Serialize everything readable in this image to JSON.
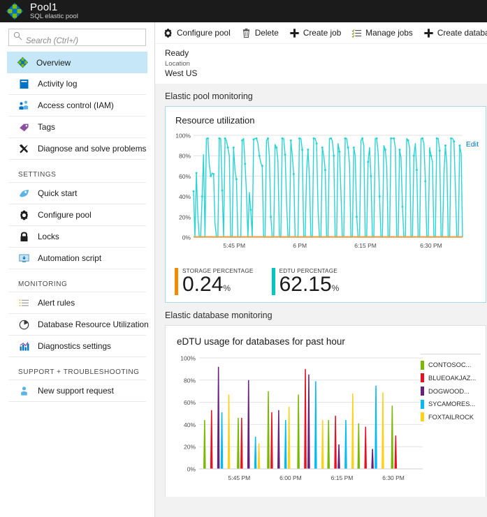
{
  "titlebar": {
    "icon": "sql-elastic-pool-icon",
    "title": "Pool1",
    "subtitle": "SQL elastic pool"
  },
  "sidebar": {
    "search": {
      "placeholder": "Search (Ctrl+/)",
      "icon": "search-icon"
    },
    "items": [
      {
        "label": "Overview",
        "icon": "overview-icon",
        "active": true
      },
      {
        "label": "Activity log",
        "icon": "activity-log-icon",
        "active": false
      },
      {
        "label": "Access control (IAM)",
        "icon": "access-control-icon",
        "active": false
      },
      {
        "label": "Tags",
        "icon": "tag-icon",
        "active": false
      },
      {
        "label": "Diagnose and solve problems",
        "icon": "wrench-icon",
        "active": false
      }
    ],
    "groups": [
      {
        "label": "SETTINGS",
        "items": [
          {
            "label": "Quick start",
            "icon": "rocket-icon"
          },
          {
            "label": "Configure pool",
            "icon": "gear-icon"
          },
          {
            "label": "Locks",
            "icon": "lock-icon"
          },
          {
            "label": "Automation script",
            "icon": "automation-script-icon"
          }
        ]
      },
      {
        "label": "MONITORING",
        "items": [
          {
            "label": "Alert rules",
            "icon": "alert-rules-icon"
          },
          {
            "label": "Database Resource Utilization",
            "icon": "pie-chart-icon"
          },
          {
            "label": "Diagnostics settings",
            "icon": "bar-chart-icon"
          }
        ]
      },
      {
        "label": "SUPPORT + TROUBLESHOOTING",
        "items": [
          {
            "label": "New support request",
            "icon": "support-request-icon"
          }
        ]
      }
    ]
  },
  "toolbar": {
    "buttons": [
      {
        "label": "Configure pool",
        "icon": "gear-icon"
      },
      {
        "label": "Delete",
        "icon": "trash-icon"
      },
      {
        "label": "Create job",
        "icon": "plus-icon"
      },
      {
        "label": "Manage jobs",
        "icon": "list-icon"
      },
      {
        "label": "Create database",
        "icon": "plus-icon"
      },
      {
        "label": "",
        "icon": "pin-icon"
      }
    ]
  },
  "status": {
    "state": "Ready",
    "location_label": "Location",
    "location_value": "West US"
  },
  "sections": {
    "pool_monitoring_title": "Elastic pool monitoring",
    "database_monitoring_title": "Elastic database monitoring"
  },
  "resource_tile": {
    "title": "Resource utilization",
    "edit_label": "Edit",
    "metrics": [
      {
        "label": "STORAGE PERCENTAGE",
        "value": "0.24",
        "unit": "%",
        "color": "#f28b00"
      },
      {
        "label": "EDTU PERCENTAGE",
        "value": "62.15",
        "unit": "%",
        "color": "#00c6c6"
      }
    ]
  },
  "edtu_tile": {
    "title": "eDTU usage for databases for past hour"
  },
  "chart_data": [
    {
      "type": "line",
      "title": "Resource utilization",
      "xlabel": "",
      "ylabel": "",
      "ylim": [
        0,
        100
      ],
      "ytick_labels": [
        "0%",
        "20%",
        "40%",
        "60%",
        "80%",
        "100%"
      ],
      "yticks": [
        0,
        20,
        40,
        60,
        80,
        100
      ],
      "xtick_labels": [
        "5:45 PM",
        "6 PM",
        "6:15 PM",
        "6:30 PM"
      ],
      "grid": true,
      "legend": "none",
      "series": [
        {
          "name": "EDTU PERCENTAGE",
          "color": "#2bd4d4",
          "values": [
            45,
            0,
            63,
            22,
            0,
            0,
            40,
            81,
            0,
            97,
            97,
            72,
            60,
            63,
            62,
            14,
            0,
            0,
            97,
            97,
            46,
            0,
            97,
            95,
            88,
            80,
            0,
            0,
            88,
            65,
            57,
            0,
            0,
            0,
            95,
            97,
            72,
            43,
            0,
            44,
            27,
            0,
            96,
            97,
            97,
            92,
            80,
            73,
            70,
            0,
            0,
            95,
            97,
            80,
            20,
            0,
            0,
            91,
            88,
            75,
            0,
            0,
            97,
            97,
            81,
            35,
            0,
            0,
            95,
            80,
            62,
            0,
            0,
            0,
            97,
            97,
            86,
            0,
            0,
            64,
            86,
            58,
            0,
            0,
            97,
            97,
            92,
            27,
            0,
            0,
            88,
            80,
            66,
            0,
            0,
            97,
            97,
            95,
            80,
            0,
            0,
            92,
            84,
            45,
            0,
            0,
            97,
            97,
            88,
            72,
            0,
            0,
            88,
            80,
            20,
            0,
            0,
            95,
            97,
            90,
            0,
            0,
            74,
            88,
            60,
            0,
            0,
            97,
            97,
            83,
            40,
            0,
            0,
            90,
            86,
            70,
            0,
            0,
            97,
            97,
            97,
            88,
            0,
            0,
            86,
            78,
            30,
            0,
            0,
            97,
            95,
            88,
            0,
            0,
            80,
            92,
            66,
            0,
            0,
            97,
            97,
            92,
            55,
            0,
            0,
            88,
            80,
            74,
            0,
            0,
            97,
            97,
            85,
            0,
            0,
            62,
            90,
            72,
            0,
            0,
            97,
            97,
            94,
            48,
            0,
            0,
            90,
            82,
            0
          ]
        },
        {
          "name": "STORAGE PERCENTAGE",
          "color": "#f28b00",
          "values": [
            0.24
          ]
        }
      ]
    },
    {
      "type": "bar",
      "title": "eDTU usage for databases for past hour",
      "xlabel": "",
      "ylabel": "",
      "ylim": [
        0,
        100
      ],
      "ytick_labels": [
        "0%",
        "20%",
        "40%",
        "60%",
        "80%",
        "100%"
      ],
      "yticks": [
        0,
        20,
        40,
        60,
        80,
        100
      ],
      "xtick_labels": [
        "5:45 PM",
        "6:00 PM",
        "6:15 PM",
        "6:30 PM"
      ],
      "grid": true,
      "legend": "right",
      "series": [
        {
          "name": "CONTOSOC...",
          "color": "#7ab800",
          "values": [
            44,
            46,
            70,
            67,
            44,
            41,
            57
          ]
        },
        {
          "name": "BLUEOAKJAZ...",
          "color": "#e81123",
          "values": [
            53,
            46,
            51,
            90,
            48,
            38,
            30
          ]
        },
        {
          "name": "DOGWOOD...",
          "color": "#68217a",
          "values": [
            92,
            80,
            53,
            85,
            22,
            18
          ]
        },
        {
          "name": "SYCAMORES...",
          "color": "#00bcf2",
          "values": [
            51,
            29,
            44,
            79,
            44,
            75
          ]
        },
        {
          "name": "FOXTAILROCK",
          "color": "#fcd116",
          "values": [
            67,
            23,
            56,
            44,
            68,
            69
          ]
        }
      ]
    }
  ]
}
